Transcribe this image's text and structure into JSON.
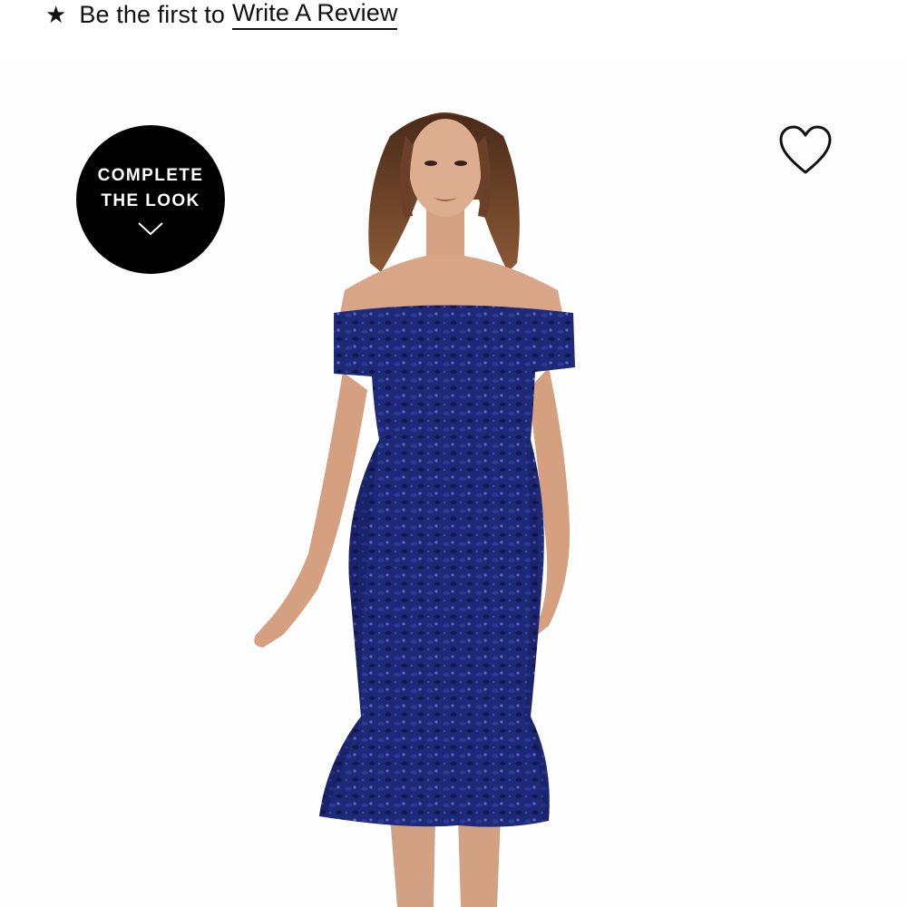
{
  "reviews": {
    "star_glyph": "★",
    "lead_text": "Be the first to",
    "link_text": "Write A Review"
  },
  "complete_the_look": {
    "line1": "COMPLETE",
    "line2": "THE LOOK",
    "icon": "chevron-down-icon"
  },
  "favorite": {
    "icon": "heart-outline-icon"
  },
  "product_image": {
    "subject": "model-in-navy-sequin-off-shoulder-dress",
    "dress_color": "#1e2a78",
    "dress_dark": "#101850",
    "dress_highlight": "#3a4aa8",
    "skin_color": "#d9a98a",
    "hair_color": "#6b4028"
  },
  "colors": {
    "text": "#111111",
    "badge_bg": "#000000",
    "badge_text": "#ffffff",
    "background": "#ffffff"
  }
}
